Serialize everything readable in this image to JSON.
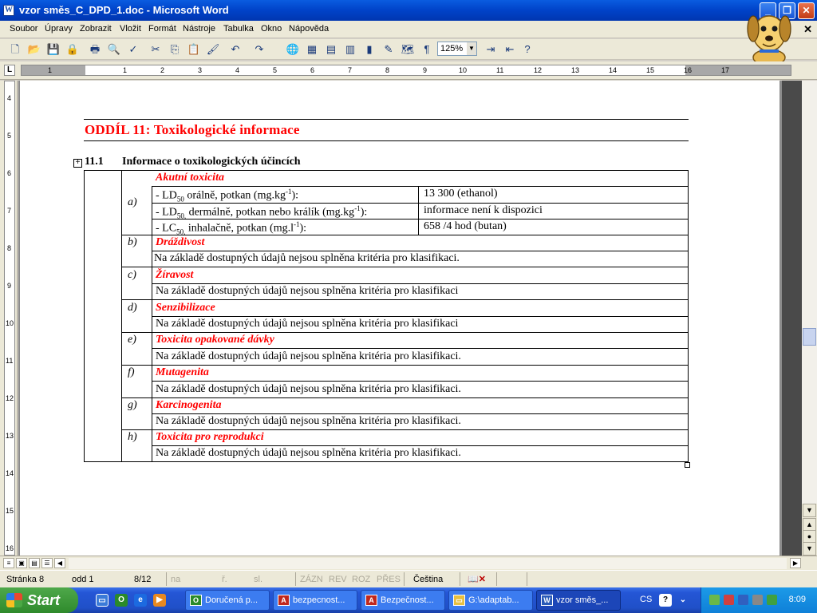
{
  "window": {
    "title": "vzor směs_C_DPD_1.doc - Microsoft Word",
    "app_icon": "word-doc-icon",
    "controls": [
      "minimize",
      "maximize",
      "close"
    ]
  },
  "menu": {
    "items": [
      "Soubor",
      "Úpravy",
      "Zobrazit",
      "Vložit",
      "Formát",
      "Nástroje",
      "Tabulka",
      "Okno",
      "Nápověda"
    ]
  },
  "toolbar": {
    "zoom": "125%"
  },
  "ruler": {
    "h_numbers": [
      "1",
      "1",
      "2",
      "3",
      "4",
      "5",
      "6",
      "7",
      "8",
      "9",
      "10",
      "11",
      "12",
      "13",
      "14",
      "15",
      "16",
      "17"
    ],
    "v_numbers": [
      "4",
      "5",
      "6",
      "7",
      "8",
      "9",
      "10",
      "11",
      "12",
      "13",
      "14",
      "15",
      "16"
    ]
  },
  "document": {
    "section_title": "ODDÍL 11: Toxikologické informace",
    "subsection_number": "11.1",
    "subsection_title": "Informace o toxikologických účincích",
    "acute": {
      "letter": "a)",
      "heading": "Akutní toxicita",
      "rows": [
        {
          "label_pre": "- LD",
          "label_sub": "50",
          "label_mid": " orálně, potkan (mg.kg",
          "label_sup": "-1",
          "label_post": "):",
          "value": "13 300 (ethanol)"
        },
        {
          "label_pre": "- LD",
          "label_sub": "50,",
          "label_mid": " dermálně, potkan nebo králík (mg.kg",
          "label_sup": "-1",
          "label_post": "):",
          "value": "informace není k dispozici"
        },
        {
          "label_pre": "- LC",
          "label_sub": "50,",
          "label_mid": " inhalačně, potkan (mg.l",
          "label_sup": "-1",
          "label_post": "):",
          "value": "658 /4 hod (butan)"
        }
      ]
    },
    "items": [
      {
        "letter": "b)",
        "heading": "Dráždivost",
        "text": "Na základě dostupných údajů nejsou splněna kritéria pro klasifikaci."
      },
      {
        "letter": "c)",
        "heading": "Žíravost",
        "text": "Na základě dostupných údajů nejsou splněna kritéria pro klasifikaci"
      },
      {
        "letter": "d)",
        "heading": "Senzibilizace",
        "text": "Na základě dostupných údajů nejsou splněna kritéria pro klasifikaci"
      },
      {
        "letter": "e)",
        "heading": "Toxicita opakované dávky",
        "text": "Na základě dostupných údajů nejsou splněna kritéria pro klasifikaci."
      },
      {
        "letter": "f)",
        "heading": "Mutagenita",
        "text": "Na základě dostupných údajů nejsou splněna kritéria pro klasifikaci."
      },
      {
        "letter": "g)",
        "heading": "Karcinogenita",
        "text": "Na základě dostupných údajů nejsou splněna kritéria pro klasifikaci."
      },
      {
        "letter": "h)",
        "heading": "Toxicita pro reprodukci",
        "text": "Na základě dostupných údajů nejsou splněna kritéria pro klasifikaci."
      }
    ]
  },
  "status": {
    "page": "Stránka 8",
    "section": "odd 1",
    "pages": "8/12",
    "at": "na",
    "line": "ř.",
    "col": "sl.",
    "rec": "ZÁZN",
    "rev": "REV",
    "ext": "ROZ",
    "ovr": "PŘES",
    "lang": "Čeština"
  },
  "taskbar": {
    "start": "Start",
    "tasks": [
      {
        "label": "Doručená p...",
        "icon": "outlook-icon"
      },
      {
        "label": "bezpecnost...",
        "icon": "acrobat-icon"
      },
      {
        "label": "Bezpečnost...",
        "icon": "acrobat-icon"
      },
      {
        "label": "G:\\adaptab...",
        "icon": "folder-icon"
      },
      {
        "label": "vzor směs_...",
        "icon": "word-icon"
      }
    ],
    "lang": "CS",
    "clock": "8:09"
  },
  "colors": {
    "section_heading": "#ff0000",
    "titlebar": "#0a5ce0",
    "taskbar": "#2456d6"
  }
}
